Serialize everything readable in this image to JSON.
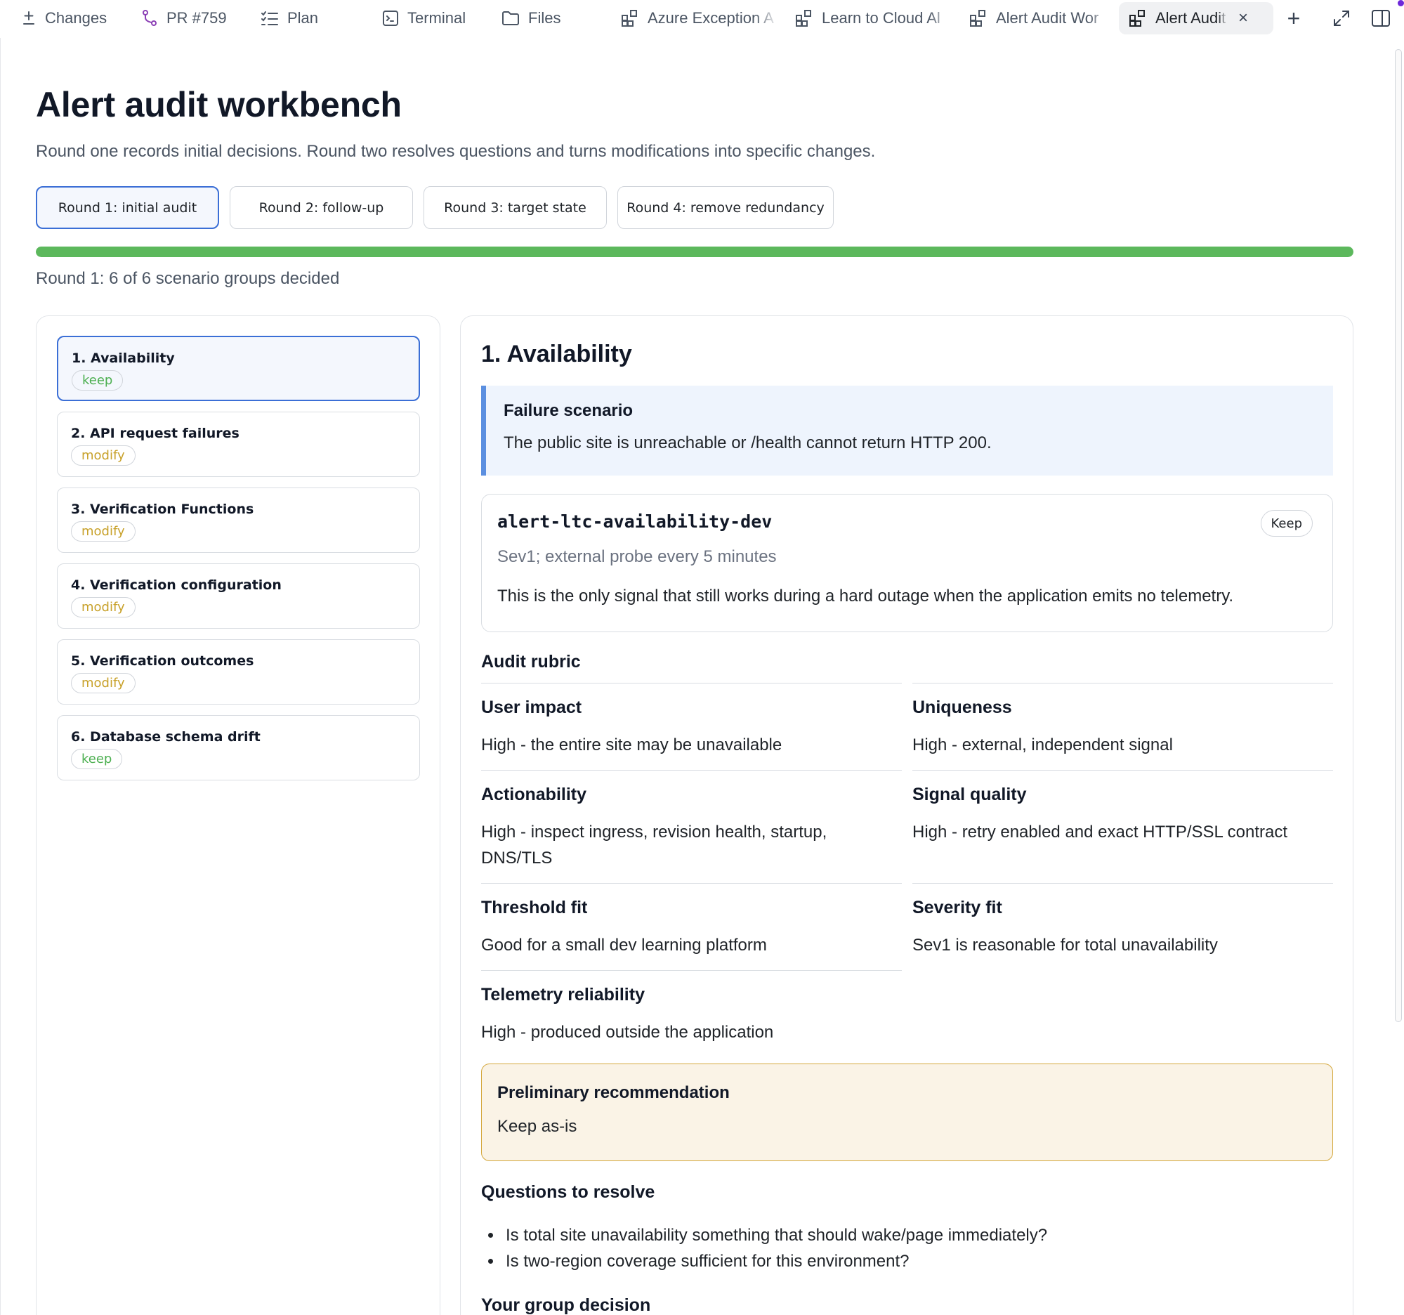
{
  "tabs": [
    {
      "label": "Changes",
      "icon": "plus-minus-icon"
    },
    {
      "label": "PR #759",
      "icon": "git-branch-icon",
      "icon_color": "#8b3fb5"
    },
    {
      "label": "Plan",
      "icon": "checklist-icon"
    },
    {
      "label": "Terminal",
      "icon": "terminal-icon"
    },
    {
      "label": "Files",
      "icon": "folder-icon"
    },
    {
      "label": "Azure Exception A",
      "icon": "widgets-icon"
    },
    {
      "label": "Learn to Cloud Al",
      "icon": "widgets-icon"
    },
    {
      "label": "Alert Audit Wor",
      "icon": "widgets-icon"
    },
    {
      "label": "Alert Audit \\",
      "icon": "widgets-icon",
      "active": true,
      "close": "×"
    }
  ],
  "toolbar": {
    "add": "+",
    "expand_icon": "expand-icon",
    "panel_icon": "split-panel-icon"
  },
  "header": {
    "title": "Alert audit workbench",
    "subtitle": "Round one records initial decisions. Round two resolves questions and turns modifications into specific changes."
  },
  "rounds": [
    {
      "label": "Round 1: initial audit",
      "active": true
    },
    {
      "label": "Round 2: follow-up"
    },
    {
      "label": "Round 3: target state"
    },
    {
      "label": "Round 4: remove redundancy"
    }
  ],
  "progress": {
    "text": "Round 1: 6 of 6 scenario groups decided",
    "decided": 6,
    "total": 6,
    "fraction": 1.0,
    "color": "#5cb85c"
  },
  "groups": [
    {
      "name": "1. Availability",
      "status": "keep",
      "active": true
    },
    {
      "name": "2. API request failures",
      "status": "modify"
    },
    {
      "name": "3. Verification Functions",
      "status": "modify"
    },
    {
      "name": "4. Verification configuration",
      "status": "modify"
    },
    {
      "name": "5. Verification outcomes",
      "status": "modify"
    },
    {
      "name": "6. Database schema drift",
      "status": "keep"
    }
  ],
  "detail": {
    "title": "1. Availability",
    "scenario_label": "Failure scenario",
    "scenario_text": "The public site is unreachable or /health cannot return HTTP 200.",
    "alert": {
      "name": "alert-ltc-availability-dev",
      "meta": "Sev1; external probe every 5 minutes",
      "description": "This is the only signal that still works during a hard outage when the application emits no telemetry.",
      "action_label": "Keep"
    },
    "rubric_heading": "Audit rubric",
    "rubric": [
      {
        "key": "User impact",
        "value": "High - the entire site may be unavailable"
      },
      {
        "key": "Uniqueness",
        "value": "High - external, independent signal"
      },
      {
        "key": "Actionability",
        "value": "High - inspect ingress, revision health, startup, DNS/TLS"
      },
      {
        "key": "Signal quality",
        "value": "High - retry enabled and exact HTTP/SSL contract"
      },
      {
        "key": "Threshold fit",
        "value": "Good for a small dev learning platform"
      },
      {
        "key": "Severity fit",
        "value": "Sev1 is reasonable for total unavailability"
      },
      {
        "key": "Telemetry reliability",
        "value": "High - produced outside the application"
      }
    ],
    "recommendation_label": "Preliminary recommendation",
    "recommendation_text": "Keep as-is",
    "questions_heading": "Questions to resolve",
    "questions": [
      "Is total site unavailability something that should wake/page immediately?",
      "Is two-region coverage sufficient for this environment?"
    ],
    "decision_heading": "Your group decision"
  },
  "colors": {
    "accent": "#3b6fd6",
    "keep": "#4caf50",
    "modify": "#c8a12a",
    "scenario_border": "#5b8fe0",
    "recommendation_border": "#d4a73c"
  }
}
